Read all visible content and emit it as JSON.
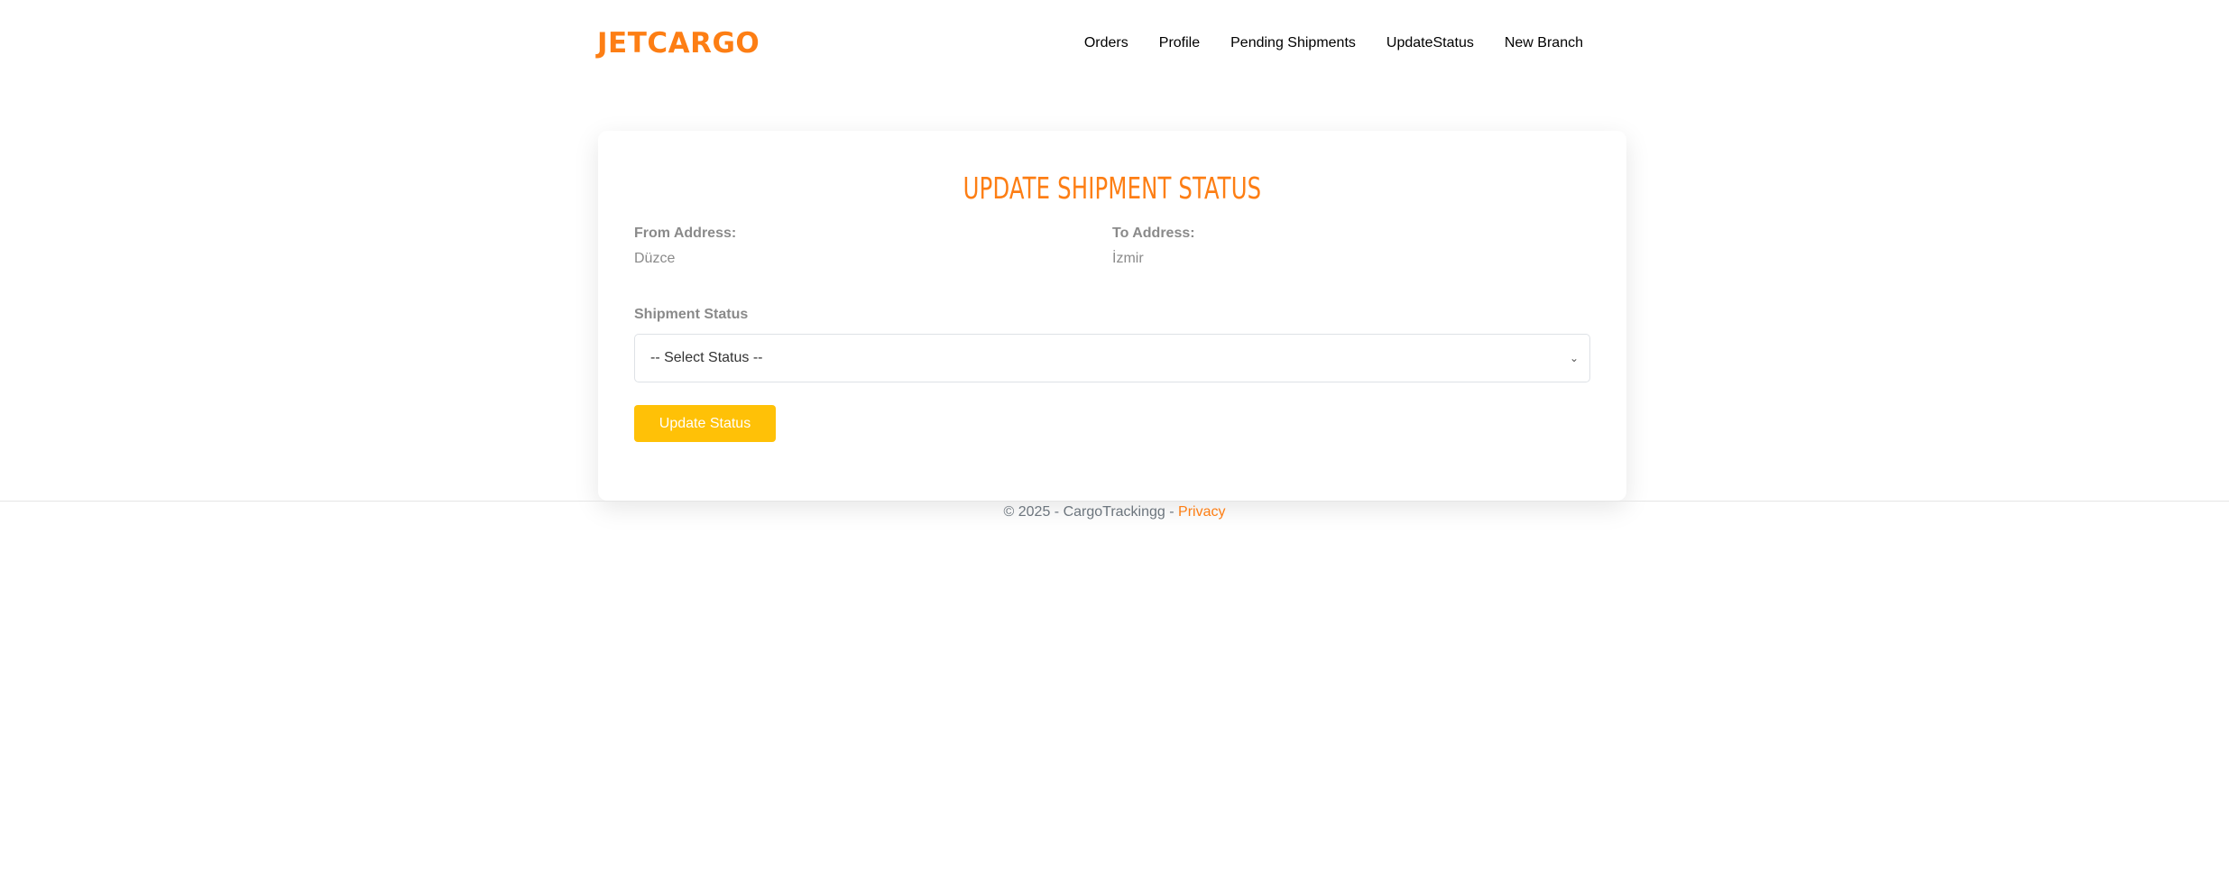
{
  "brand": "JETCARGO",
  "nav": {
    "items": [
      "Orders",
      "Profile",
      "Pending Shipments",
      "UpdateStatus",
      "New Branch"
    ]
  },
  "card": {
    "title": "UPDATE SHIPMENT STATUS",
    "from_label": "From Address:",
    "from_value": "Düzce",
    "to_label": "To Address:",
    "to_value": "İzmir",
    "status_label": "Shipment Status",
    "select_value": "-- Select Status --",
    "button_label": "Update Status"
  },
  "footer": {
    "text": "© 2025 - CargoTrackingg - ",
    "link": "Privacy"
  },
  "colors": {
    "accent": "#fd7e14",
    "button": "#ffc107"
  }
}
